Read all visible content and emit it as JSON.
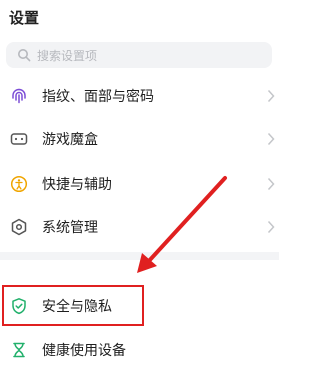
{
  "header": {
    "title": "设置"
  },
  "search": {
    "placeholder": "搜索设置项"
  },
  "items": [
    {
      "label": "指纹、面部与密码",
      "icon": "fingerprint-icon"
    },
    {
      "label": "游戏魔盒",
      "icon": "game-box-icon"
    },
    {
      "label": "快捷与辅助",
      "icon": "accessibility-icon"
    },
    {
      "label": "系统管理",
      "icon": "system-management-icon"
    },
    {
      "label": "安全与隐私",
      "icon": "shield-check-icon"
    },
    {
      "label": "健康使用设备",
      "icon": "hourglass-icon"
    }
  ],
  "colors": {
    "accent_purple": "#7c4dd6",
    "accent_orange": "#f0a500",
    "accent_green": "#21b06b",
    "annotation_red": "#e02020"
  }
}
